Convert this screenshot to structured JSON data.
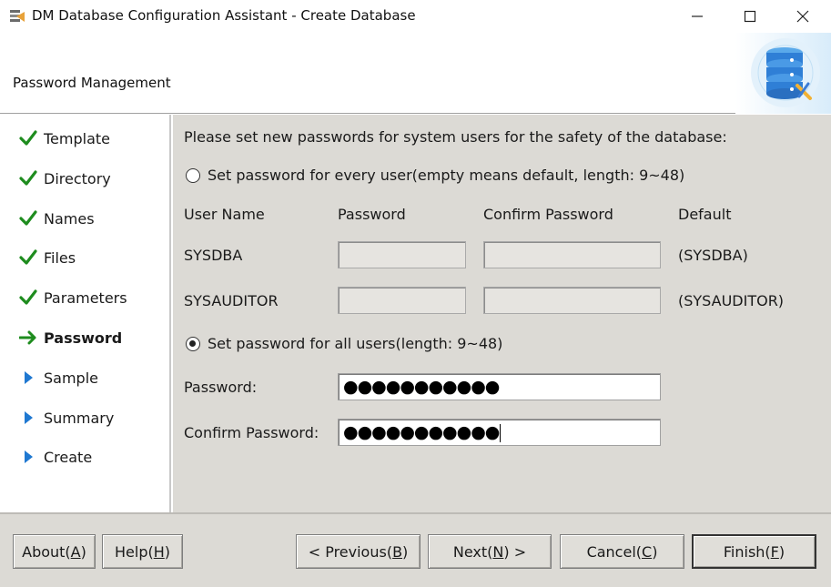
{
  "window": {
    "title": "DM Database Configuration Assistant - Create Database",
    "controls": [
      "minimize",
      "maximize",
      "close"
    ]
  },
  "header": {
    "title": "Password Management"
  },
  "sidebar": {
    "steps": [
      {
        "label": "Template",
        "status": "done"
      },
      {
        "label": "Directory",
        "status": "done"
      },
      {
        "label": "Names",
        "status": "done"
      },
      {
        "label": "Files",
        "status": "done"
      },
      {
        "label": "Parameters",
        "status": "done"
      },
      {
        "label": "Password",
        "status": "current"
      },
      {
        "label": "Sample",
        "status": "pending"
      },
      {
        "label": "Summary",
        "status": "pending"
      },
      {
        "label": "Create",
        "status": "pending"
      }
    ]
  },
  "main": {
    "intro": "Please set new passwords for system users for the safety of the database:",
    "option_each": {
      "label": "Set password for every user(empty means default, length: 9~48)",
      "selected": false
    },
    "columns": {
      "user_name": "User Name",
      "password": "Password",
      "confirm": "Confirm Password",
      "default": "Default"
    },
    "users": [
      {
        "name": "SYSDBA",
        "password": "",
        "confirm": "",
        "default": "(SYSDBA)"
      },
      {
        "name": "SYSAUDITOR",
        "password": "",
        "confirm": "",
        "default": "(SYSAUDITOR)"
      }
    ],
    "option_all": {
      "label": "Set password for all users(length: 9~48)",
      "selected": true
    },
    "password_label": "Password:",
    "password_value": "●●●●●●●●●●●",
    "confirm_label": "Confirm Password:",
    "confirm_value": "●●●●●●●●●●●"
  },
  "footer": {
    "about": {
      "text": "About(",
      "key": "A",
      "end": ")"
    },
    "help": {
      "text": "Help(",
      "key": "H",
      "end": ")"
    },
    "previous": {
      "text": "< Previous(",
      "key": "B",
      "end": ")"
    },
    "next": {
      "text": "Next(",
      "key": "N",
      "end": ") >"
    },
    "cancel": {
      "text": "Cancel(",
      "key": "C",
      "end": ")"
    },
    "finish": {
      "text": "Finish(",
      "key": "F",
      "end": ")"
    }
  },
  "colors": {
    "check_green": "#1e8c1e",
    "arrow_green": "#1e8c1e",
    "pending_blue": "#1f78d1",
    "panel_bg": "#dcdad5"
  }
}
